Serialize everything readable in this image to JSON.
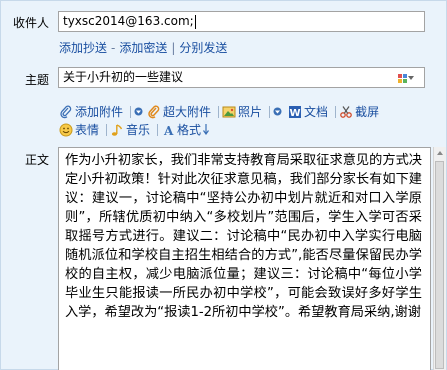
{
  "recipient": {
    "label": "收件人",
    "value": "tyxsc2014@163.com;"
  },
  "recipient_links": {
    "add_cc": "添加抄送",
    "separator1": "-",
    "add_bcc": "添加密送",
    "separator2": "|",
    "separate_send": "分别发送"
  },
  "subject": {
    "label": "主题",
    "value": "关于小升初的一些建议"
  },
  "toolbar": {
    "add_attachment": "添加附件",
    "large_attachment": "超大附件",
    "photo": "照片",
    "document": "文档",
    "screenshot": "截屏",
    "emoticon": "表情",
    "music": "音乐",
    "format": "格式"
  },
  "body": {
    "label": "正文",
    "text": "作为小升初家长，我们非常支持教育局采取征求意见的方式决定小升初政策！针对此次征求意见稿，我们部分家长有如下建议：建议一，讨论稿中“坚持公办初中划片就近和对口入学原则”，所辖优质初中纳入“多校划片”范围后，学生入学可否采取摇号方式进行。建议二：讨论稿中“民办初中入学实行电脑随机派位和学校自主招生相结合的方式”,能否尽量保留民办学校的自主权，减少电脑派位量；建议三：讨论稿中“每位小学毕业生只能报读一所民办初中学校”，可能会致误好多好学生入学，希望改为“报读1-2所初中学校”。希望教育局采纳,谢谢"
  },
  "colors": {
    "link": "#1a4fa0",
    "panel_bg": "#eaf3fb"
  }
}
